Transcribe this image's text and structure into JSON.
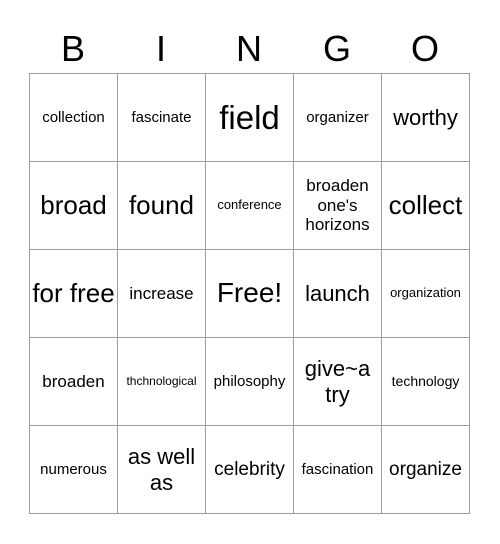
{
  "header": [
    "B",
    "I",
    "N",
    "G",
    "O"
  ],
  "grid_border_color": "#7aa1dc",
  "cells": [
    [
      "collection",
      "fascinate",
      "field",
      "organizer",
      "worthy"
    ],
    [
      "broad",
      "found",
      "conference",
      "broaden one's horizons",
      "collect"
    ],
    [
      "for free",
      "increase",
      "Free!",
      "launch",
      "organization"
    ],
    [
      "broaden",
      "thchnological",
      "philosophy",
      "give~a try",
      "technology"
    ],
    [
      "numerous",
      "as well as",
      "celebrity",
      "fascination",
      "organize"
    ]
  ]
}
